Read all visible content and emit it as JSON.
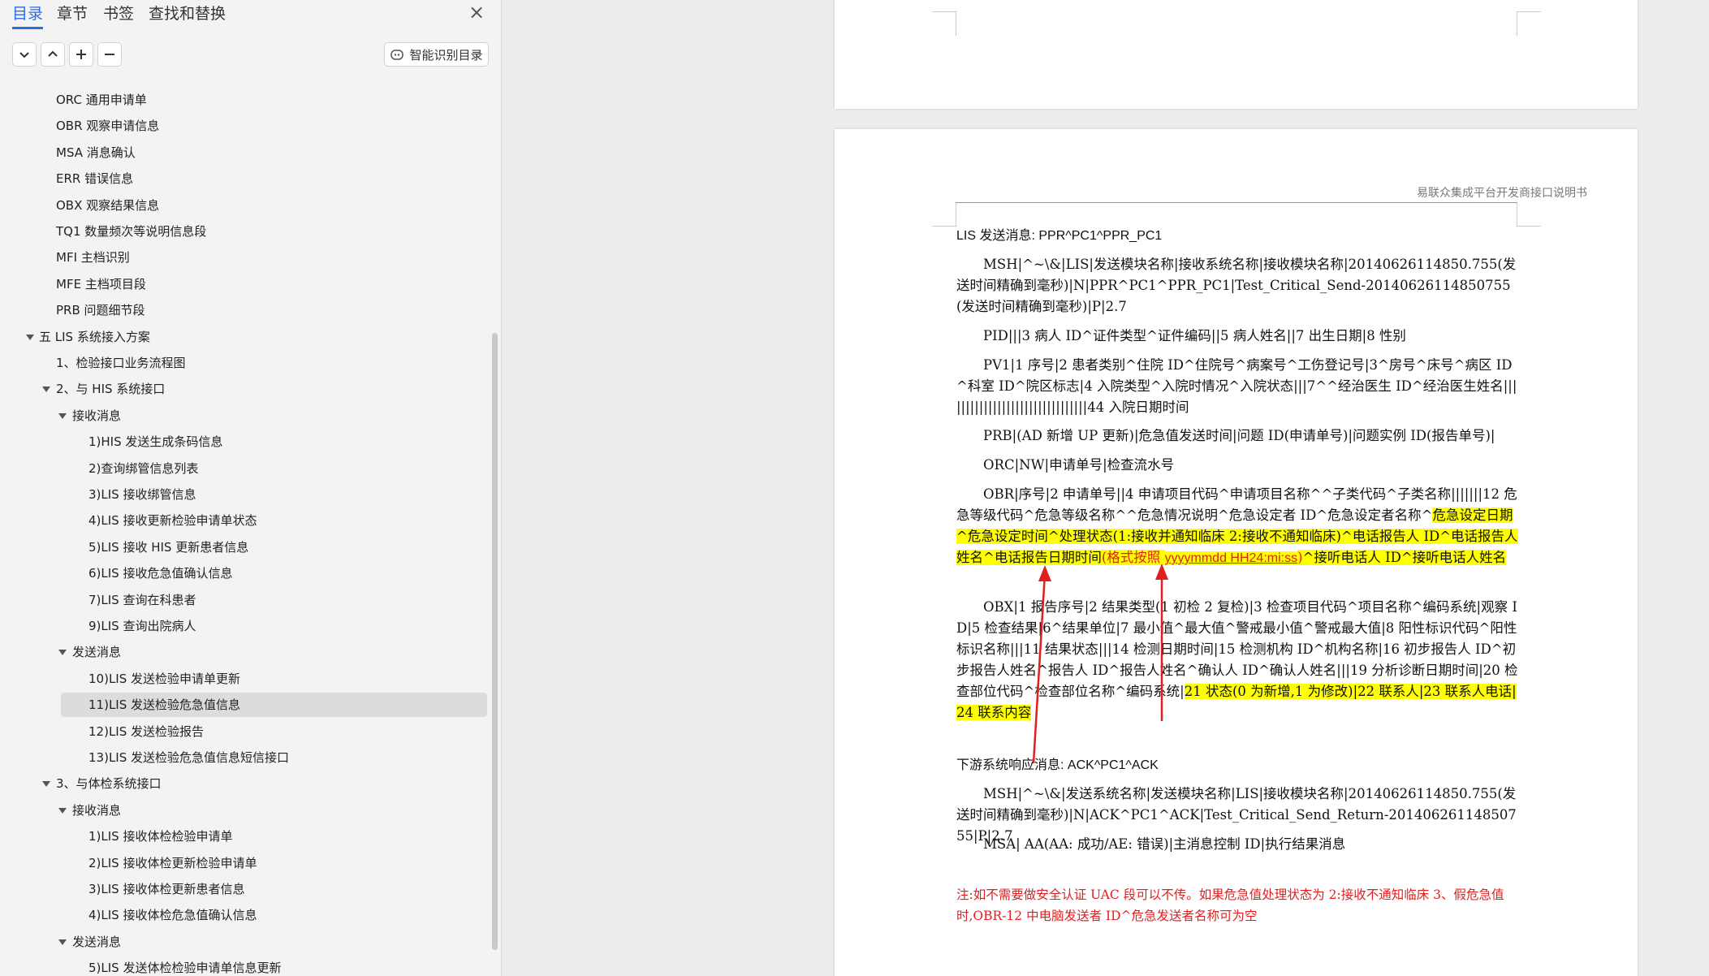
{
  "sidebar": {
    "tabs": [
      "目录",
      "章节",
      "书签",
      "查找和替换"
    ],
    "close_label": "×",
    "smart_button": "智能识别目录",
    "toc": [
      {
        "label": "ORC 通用申请单",
        "level": 2
      },
      {
        "label": "OBR 观察申请信息",
        "level": 2
      },
      {
        "label": "MSA 消息确认",
        "level": 2
      },
      {
        "label": "ERR 错误信息",
        "level": 2
      },
      {
        "label": "OBX 观察结果信息",
        "level": 2
      },
      {
        "label": "TQ1 数量频次等说明信息段",
        "level": 2
      },
      {
        "label": "MFI 主档识别",
        "level": 2
      },
      {
        "label": "MFE 主档项目段",
        "level": 2
      },
      {
        "label": "PRB 问题细节段",
        "level": 2
      },
      {
        "label": "五 LIS 系统接入方案",
        "level": 0,
        "expanded": true
      },
      {
        "label": "1、检验接口业务流程图",
        "level": 1
      },
      {
        "label": "2、与 HIS 系统接口",
        "level": 1,
        "expanded": true
      },
      {
        "label": "接收消息",
        "level": 2,
        "expanded": true
      },
      {
        "label": "1)HIS 发送生成条码信息",
        "level": 3
      },
      {
        "label": "2)查询绑管信息列表",
        "level": 3
      },
      {
        "label": "3)LIS 接收绑管信息",
        "level": 3
      },
      {
        "label": "4)LIS 接收更新检验申请单状态",
        "level": 3
      },
      {
        "label": "5)LIS 接收 HIS 更新患者信息",
        "level": 3
      },
      {
        "label": "6)LIS 接收危急值确认信息",
        "level": 3
      },
      {
        "label": "7)LIS 查询在科患者",
        "level": 3
      },
      {
        "label": "9)LIS 查询出院病人",
        "level": 3
      },
      {
        "label": "发送消息",
        "level": 2,
        "expanded": true
      },
      {
        "label": "10)LIS 发送检验申请单更新",
        "level": 3
      },
      {
        "label": "11)LIS 发送检验危急值信息",
        "level": 3,
        "selected": true
      },
      {
        "label": "12)LIS 发送检验报告",
        "level": 3
      },
      {
        "label": "13)LIS 发送检验危急值信息短信接口",
        "level": 3
      },
      {
        "label": "3、与体检系统接口",
        "level": 1,
        "expanded": true
      },
      {
        "label": "接收消息",
        "level": 2,
        "expanded": true
      },
      {
        "label": "1)LIS 接收体检检验申请单",
        "level": 3
      },
      {
        "label": "2)LIS 接收体检更新检验申请单",
        "level": 3
      },
      {
        "label": "3)LIS 接收体检更新患者信息",
        "level": 3
      },
      {
        "label": "4)LIS 接收体检危急值确认信息",
        "level": 3
      },
      {
        "label": "发送消息",
        "level": 2,
        "expanded": true
      },
      {
        "label": "5)LIS 发送体检检验申请单信息更新",
        "level": 3
      }
    ]
  },
  "doc": {
    "header": "易联众集成平台开发商接口说明书",
    "lis_title": "LIS 发送消息: PPR^PC1^PPR_PC1",
    "msh": "MSH|^~\\&|LIS|发送模块名称|接收系统名称|接收模块名称|20140626114850.755(发送时间精确到毫秒)|N|PPR^PC1^PPR_PC1|Test_Critical_Send-20140626114850755(发送时间精确到毫秒)|P|2.7",
    "pid": "PID|||3 病人 ID^证件类型^证件编码||5 病人姓名||7 出生日期|8 性别",
    "pv1": "PV1|1 序号|2 患者类别^住院 ID^住院号^病案号^工伤登记号|3^房号^床号^病区 ID ^科室 ID^院区标志|4 入院类型^入院时情况^入院状态|||7^^经治医生 ID^经治医生姓名||||||||||||||||||||||||||||||||44 入院日期时间",
    "prb": "PRB|(AD 新增 UP 更新)|危急值发送时间|问题 ID(申请单号)|问题实例 ID(报告单号)|",
    "orc": "ORC|NW|申请单号|检查流水号",
    "obr_plain": "OBR|序号|2 申请单号||4 申请项目代码^申请项目名称^^子类代码^子类名称|||||||12 危急等级代码^危急等级名称^^危急情况说明^危急设定者 ID^危急设定者名称^",
    "obr_hl_1": "危急设定日期^危急设定时间^处理状态(1:接收并通知临床 2:接收不通知临床)^电话报告人 ID^电话报告人姓名^电话报告日期时间",
    "obr_red_1": "(格式按照 ",
    "obr_red_2": "yyyymmdd HH24:mi:ss",
    "obr_red_3": ")",
    "obr_hl_2": "^接听电话人 ID^接听电话人姓名",
    "obx_plain": "OBX|1 报告序号|2 结果类型(1 初检 2 复检)|3 检查项目代码^项目名称^编码系统|观察 ID|5 检查结果|6^结果单位|7 最小值^最大值^警戒最小值^警戒最大值|8 阳性标识代码^阳性标识名称|||11 结果状态|||14 检测日期时间|15 检测机构 ID^机构名称|16 初步报告人 ID^初步报告人姓名^报告人 ID^报告人姓名^确认人 ID^确认人姓名|||19 分析诊断日期时间|20 检查部位代码^检查部位名称^编码系统|",
    "obx_hl": "21 状态(0 为新增,1 为修改)|22 联系人|23 联系人电话|24 联系内容",
    "downstream_title": "下游系统响应消息: ACK^PC1^ACK",
    "ack_msh": "MSH|^~\\&|发送系统名称|发送模块名称|LIS|接收模块名称|20140626114850.755(发送时间精确到毫秒)|N|ACK^PC1^ACK|Test_Critical_Send_Return-20140626114850755|P|2.7",
    "ack_msa": "MSA| AA(AA: 成功/AE: 错误)|主消息控制 ID|执行结果消息",
    "note": "注:如不需要做安全认证 UAC 段可以不传。如果危急值处理状态为 2:接收不通知临床 3、假危急值时,OBR-12 中电脑发送者 ID^危急发送者名称可为空"
  },
  "colors": {
    "accent": "#2b6cdf",
    "highlight": "#ffff00",
    "annotation_red": "#e02020"
  }
}
